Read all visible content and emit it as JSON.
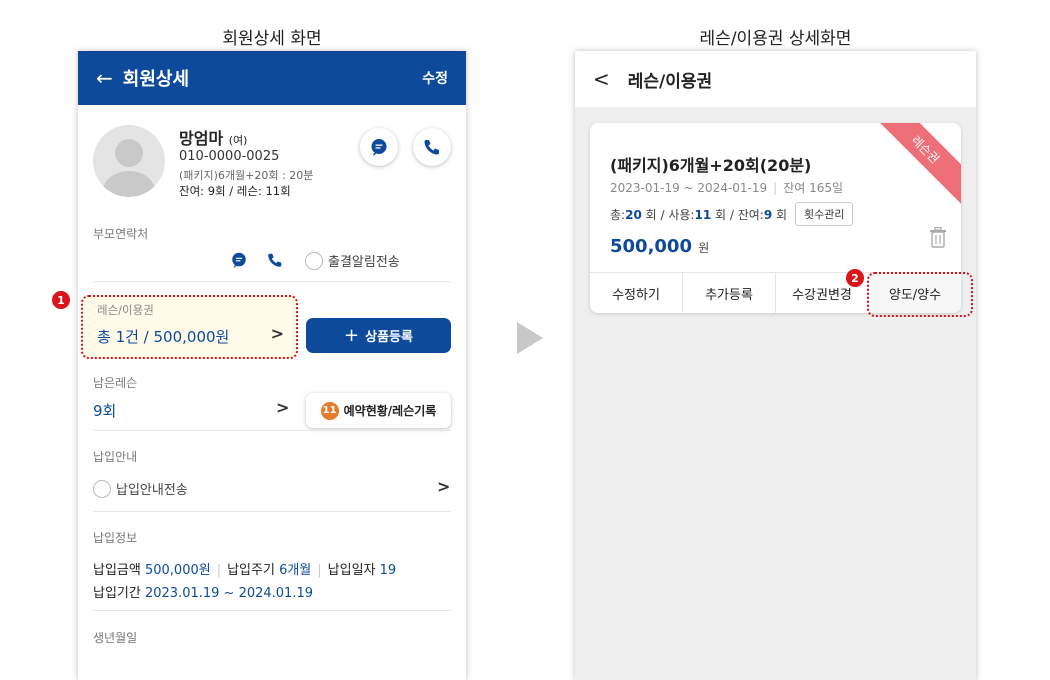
{
  "captions": {
    "left": "회원상세 화면",
    "right": "레슨/이용권 상세화면"
  },
  "member_screen": {
    "header": {
      "back": "←",
      "title": "회원상세",
      "edit": "수정"
    },
    "profile": {
      "name": "망엄마",
      "gender": "(여)",
      "phone": "010-0000-0025",
      "package": "(패키지)6개월+20회 : 20분",
      "remaining": "잔여: 9회 / 레슨: 11회"
    },
    "parent_contact": {
      "label": "부모연락처",
      "radio_label": "출결알림전송"
    },
    "lesson_pass": {
      "label": "레슨/이용권",
      "value": "총 1건 / 500,000원",
      "chevron": ">",
      "product_button": "상품등록",
      "plus": "+",
      "badge": "1"
    },
    "remaining_lessons": {
      "label": "남은레슨",
      "value": "9회",
      "chevron": ">",
      "reservation_button": "예약현황/레슨기록",
      "reservation_badge": "11"
    },
    "payment_guide": {
      "label": "납입안내",
      "radio_label": "납입안내전송",
      "chevron": ">"
    },
    "payment_info": {
      "label": "납입정보",
      "amount_label": "납입금액",
      "amount": "500,000원",
      "cycle_label": "납입주기",
      "cycle": "6개월",
      "day_label": "납입일자",
      "day": "19",
      "period_label": "납입기간",
      "period": "2023.01.19 ~ 2024.01.19"
    },
    "birthday": {
      "label": "생년월일"
    }
  },
  "pass_screen": {
    "header": {
      "back": "<",
      "title": "레슨/이용권"
    },
    "card": {
      "ribbon": "레슨권",
      "title": "(패키지)6개월+20회(20분)",
      "dates": "2023-01-19 ~ 2024-01-19",
      "remaining_days": "잔여 165일",
      "count_total_label": "총:",
      "count_total": "20",
      "count_used_label": "회 / 사용:",
      "count_used": "11",
      "count_left_label": "회 / 잔여:",
      "count_left": "9",
      "count_suffix": "회",
      "count_manage_button": "횟수관리",
      "price": "500,000",
      "price_unit": "원",
      "actions": [
        "수정하기",
        "추가등록",
        "수강권변경",
        "양도/양수"
      ],
      "badge": "2"
    }
  },
  "colors": {
    "primary": "#0d4a9c",
    "highlight": "#d9141a",
    "ribbon": "#ee6f78",
    "orange_badge": "#e57c2b"
  }
}
